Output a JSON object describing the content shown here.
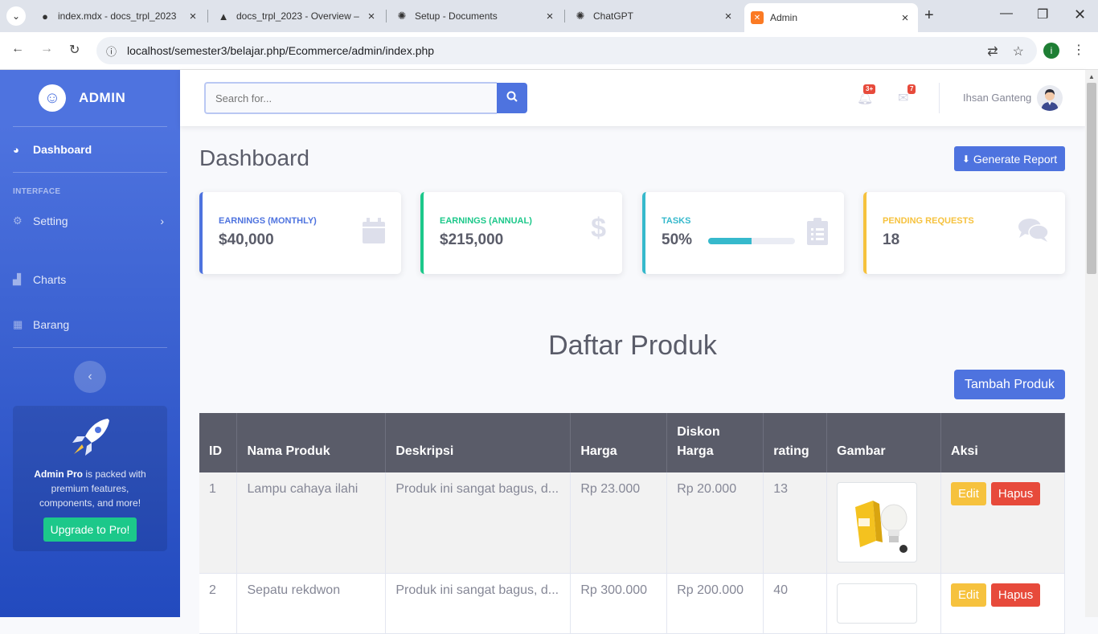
{
  "browser": {
    "tabs": [
      {
        "title": "index.mdx - docs_trpl_2023",
        "icon": "github-icon"
      },
      {
        "title": "docs_trpl_2023 - Overview –",
        "icon": "vercel-icon"
      },
      {
        "title": "Setup - Documents",
        "icon": "openai-icon"
      },
      {
        "title": "ChatGPT",
        "icon": "openai-icon"
      },
      {
        "title": "Admin",
        "icon": "xampp-icon"
      }
    ],
    "active_tab": 4,
    "url": "localhost/semester3/belajar.php/Ecommerce/admin/index.php",
    "profile_initial": "i"
  },
  "sidebar": {
    "brand": "ADMIN",
    "dashboard_label": "Dashboard",
    "heading_interface": "INTERFACE",
    "setting_label": "Setting",
    "charts_label": "Charts",
    "barang_label": "Barang",
    "promo": {
      "strong": "Admin Pro",
      "text": " is packed with premium features, components, and more!",
      "button": "Upgrade to Pro!"
    }
  },
  "topbar": {
    "search_placeholder": "Search for...",
    "alerts_badge": "3+",
    "messages_badge": "7",
    "user_name": "Ihsan Ganteng"
  },
  "page": {
    "title": "Dashboard",
    "generate_report": "Generate Report",
    "cards": [
      {
        "label": "EARNINGS (MONTHLY)",
        "value": "$40,000",
        "color": "#4e73df",
        "icon": "calendar-icon"
      },
      {
        "label": "EARNINGS (ANNUAL)",
        "value": "$215,000",
        "color": "#1cc88a",
        "icon": "dollar-icon"
      },
      {
        "label": "TASKS",
        "value": "50%",
        "color": "#36b9cc",
        "icon": "clipboard-list-icon",
        "progress": 0.5
      },
      {
        "label": "PENDING REQUESTS",
        "value": "18",
        "color": "#f6c23e",
        "icon": "comments-icon"
      }
    ],
    "section_title": "Daftar Produk",
    "add_button": "Tambah Produk",
    "table": {
      "headers": [
        "ID",
        "Nama Produk",
        "Deskripsi",
        "Harga",
        "Diskon Harga",
        "rating",
        "Gambar",
        "Aksi"
      ],
      "rows": [
        {
          "id": "1",
          "nama": "Lampu cahaya ilahi",
          "deskripsi": "Produk ini sangat bagus, d...",
          "harga": "Rp 23.000",
          "diskon": "Rp 20.000",
          "rating": "13"
        },
        {
          "id": "2",
          "nama": "Sepatu rekdwon",
          "deskripsi": "Produk ini sangat bagus, d...",
          "harga": "Rp 300.000",
          "diskon": "Rp 200.000",
          "rating": "40"
        }
      ],
      "edit_label": "Edit",
      "delete_label": "Hapus"
    }
  }
}
